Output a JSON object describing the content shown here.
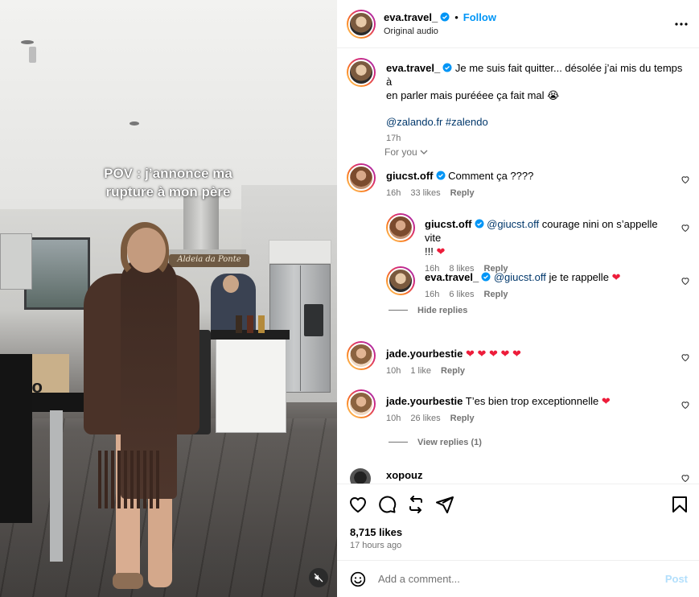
{
  "media": {
    "overlay_line1": "POV : j’annonce ma",
    "overlay_line2": "rupture à mon père",
    "sign_text": "Aldeia da Ponte",
    "box_text": "do"
  },
  "header": {
    "username": "eva.travel_",
    "follow_label": "Follow",
    "separator": "•",
    "audio_label": "Original audio",
    "more_label": "•••"
  },
  "caption": {
    "username": "eva.travel_",
    "text_line1": "Je me suis fait quitter... désolée j’ai mis du temps à",
    "text_line2": "en parler mais purééee ça fait mal 😭",
    "tags": "@zalando.fr #zalendo",
    "time": "17h"
  },
  "section_label": "For you",
  "comments": [
    {
      "username": "giucst.off",
      "text": "Comment ça ????",
      "time": "16h",
      "likes": "33 likes",
      "reply": "Reply"
    },
    {
      "username": "giucst.off",
      "mention": "@giucst.off",
      "text_line1": "courage nini on s’appelle vite",
      "text_line2": "!!!",
      "time": "16h",
      "likes": "8 likes",
      "reply": "Reply"
    },
    {
      "username": "eva.travel_",
      "mention": "@giucst.off",
      "text": "je te rappelle",
      "time": "16h",
      "likes": "6 likes",
      "reply": "Reply"
    },
    {
      "username": "jade.yourbestie",
      "text": "",
      "time": "10h",
      "likes": "1 like",
      "reply": "Reply"
    },
    {
      "username": "jade.yourbestie",
      "text": "T’es bien trop exceptionnelle",
      "time": "10h",
      "likes": "26 likes",
      "reply": "Reply"
    },
    {
      "username": "xopouz"
    }
  ],
  "hide_replies": "Hide replies",
  "view_replies": "View replies (1)",
  "likes": "8,715 likes",
  "posted_ago": "17 hours ago",
  "comment_placeholder": "Add a comment...",
  "post_label": "Post",
  "colors": {
    "link": "#00376b",
    "follow": "#0095f6",
    "heart": "#ed1c3a",
    "meta": "#737373"
  }
}
